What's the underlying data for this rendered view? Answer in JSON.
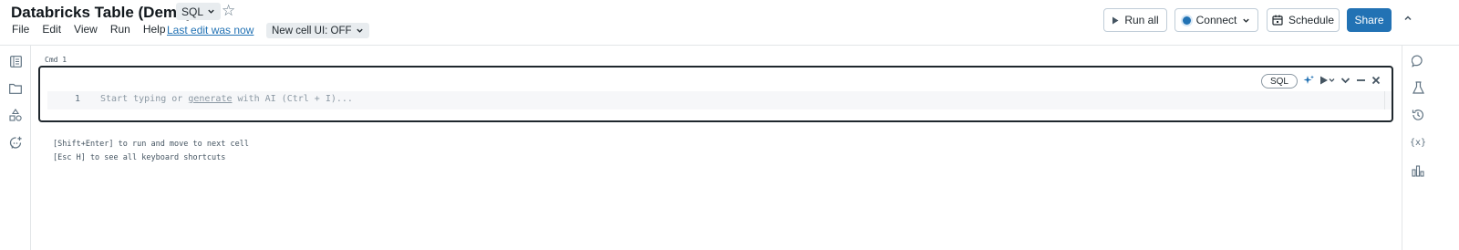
{
  "notebook": {
    "title": "Databricks Table (Demo)",
    "language": "SQL",
    "last_edit": "Last edit was now",
    "new_cell_ui": "New cell UI: OFF"
  },
  "menu": [
    "File",
    "Edit",
    "View",
    "Run",
    "Help"
  ],
  "toolbar": {
    "run_all": "Run all",
    "connect": "Connect",
    "schedule": "Schedule",
    "share": "Share"
  },
  "cell": {
    "label": "Cmd 1",
    "language_badge": "SQL",
    "line_number": "1",
    "placeholder_before": "Start typing or ",
    "placeholder_link": "generate",
    "placeholder_after": " with AI (Ctrl + I)..."
  },
  "hints": {
    "run": "[Shift+Enter] to run and move to next cell",
    "shortcuts": "[Esc H] to see all keyboard shortcuts"
  },
  "icons": {
    "left_rail": [
      "table-of-contents-icon",
      "folder-icon",
      "shapes-icon",
      "assistant-icon"
    ],
    "right_rail": [
      "comments-icon",
      "experiment-icon",
      "history-icon",
      "variables-icon",
      "chart-icon"
    ]
  },
  "colors": {
    "accent": "#2272b4",
    "cell_border": "#1f272d"
  }
}
